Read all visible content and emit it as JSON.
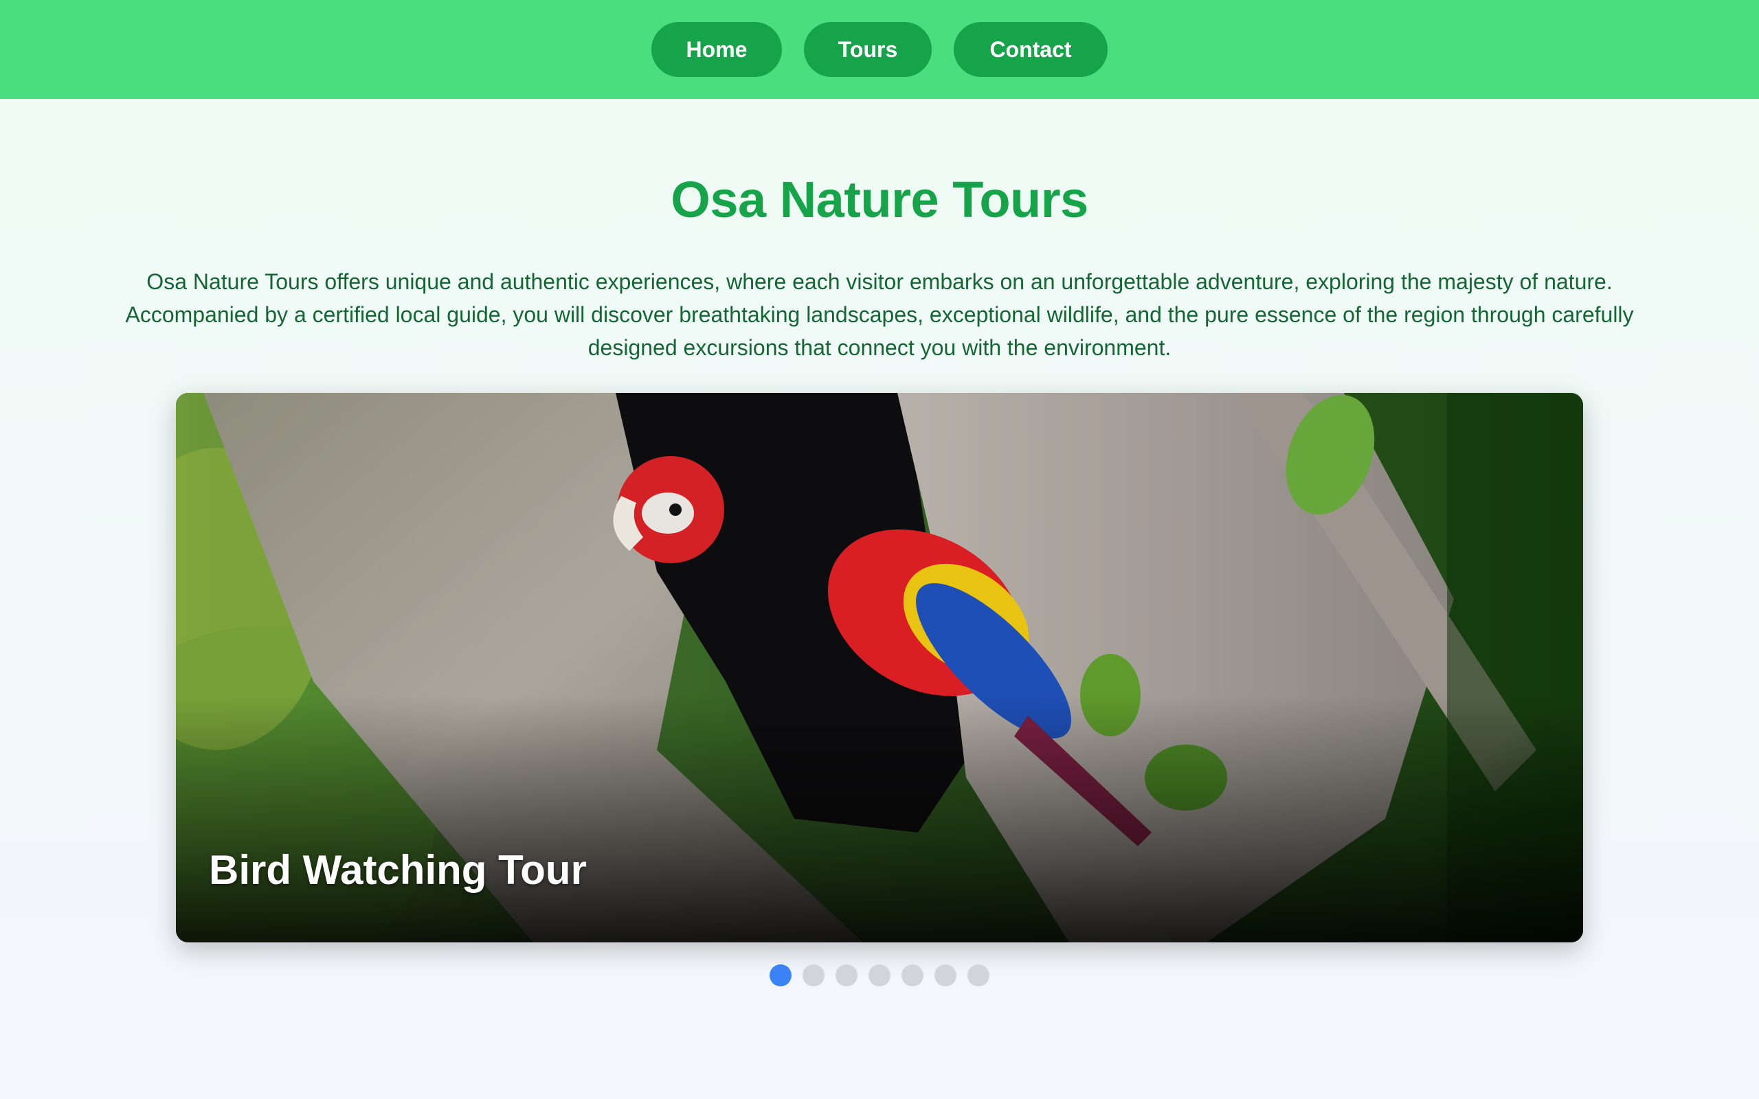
{
  "nav": {
    "home": "Home",
    "tours": "Tours",
    "contact": "Contact"
  },
  "hero": {
    "title": "Osa Nature Tours",
    "intro": "Osa Nature Tours offers unique and authentic experiences, where each visitor embarks on an unforgettable adventure, exploring the majesty of nature. Accompanied by a certified local guide, you will discover breathtaking landscapes, exceptional wildlife, and the pure essence of the region through carefully designed excursions that connect you with the environment."
  },
  "carousel": {
    "current_caption": "Bird Watching Tour",
    "slide_count": 7,
    "active_index": 0
  },
  "colors": {
    "nav_bar": "#4ade80",
    "nav_button": "#16a34a",
    "title": "#16a34a",
    "body_text": "#166534",
    "dot_active": "#3b82f6",
    "dot_inactive": "#d1d5db"
  }
}
